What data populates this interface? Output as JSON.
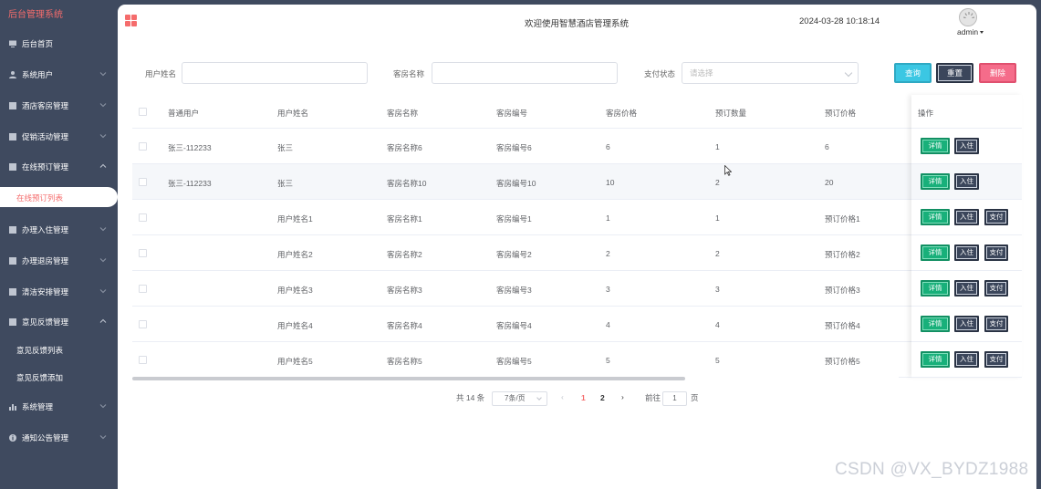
{
  "sidebar": {
    "brand": "后台管理系统",
    "items": [
      {
        "label": "后台首页",
        "icon": "monitor-icon"
      },
      {
        "label": "系统用户",
        "icon": "user-icon"
      },
      {
        "label": "酒店客房管理",
        "icon": "menu-icon"
      },
      {
        "label": "促销活动管理",
        "icon": "menu-icon"
      },
      {
        "label": "在线预订管理",
        "icon": "menu-icon",
        "expanded": true
      },
      {
        "label": "办理入住管理",
        "icon": "menu-icon"
      },
      {
        "label": "办理退房管理",
        "icon": "menu-icon"
      },
      {
        "label": "清洁安排管理",
        "icon": "menu-icon"
      },
      {
        "label": "意见反馈管理",
        "icon": "menu-icon",
        "expanded": true
      },
      {
        "label": "系统管理",
        "icon": "bar-chart-icon"
      },
      {
        "label": "通知公告管理",
        "icon": "info-icon"
      }
    ],
    "active_sub": "在线预订列表",
    "feedback_subs": [
      "意见反馈列表",
      "意见反馈添加"
    ]
  },
  "header": {
    "welcome": "欢迎使用智慧酒店管理系统",
    "datetime": "2024-03-28 10:18:14",
    "username": "admin"
  },
  "search": {
    "user_name_label": "用户姓名",
    "room_name_label": "客房名称",
    "pay_status_label": "支付状态",
    "pay_status_placeholder": "请选择",
    "query_label": "查询",
    "reset_label": "重置",
    "delete_label": "删除"
  },
  "table": {
    "headers": [
      "普通用户",
      "用户姓名",
      "客房名称",
      "客房编号",
      "客房价格",
      "预订数量",
      "预订价格",
      "操作"
    ],
    "rows": [
      {
        "user": "张三-112233",
        "name": "张三",
        "room": "客房名称6",
        "code": "客房编号6",
        "price": "6",
        "qty": "1",
        "total": "6",
        "pay": false
      },
      {
        "user": "张三-112233",
        "name": "张三",
        "room": "客房名称10",
        "code": "客房编号10",
        "price": "10",
        "qty": "2",
        "total": "20",
        "pay": false
      },
      {
        "user": "",
        "name": "用户姓名1",
        "room": "客房名称1",
        "code": "客房编号1",
        "price": "1",
        "qty": "1",
        "total": "预订价格1",
        "pay": true
      },
      {
        "user": "",
        "name": "用户姓名2",
        "room": "客房名称2",
        "code": "客房编号2",
        "price": "2",
        "qty": "2",
        "total": "预订价格2",
        "pay": true
      },
      {
        "user": "",
        "name": "用户姓名3",
        "room": "客房名称3",
        "code": "客房编号3",
        "price": "3",
        "qty": "3",
        "total": "预订价格3",
        "pay": true
      },
      {
        "user": "",
        "name": "用户姓名4",
        "room": "客房名称4",
        "code": "客房编号4",
        "price": "4",
        "qty": "4",
        "total": "预订价格4",
        "pay": true
      },
      {
        "user": "",
        "name": "用户姓名5",
        "room": "客房名称5",
        "code": "客房编号5",
        "price": "5",
        "qty": "5",
        "total": "预订价格5",
        "pay": true
      }
    ],
    "actions": {
      "detail": "详情",
      "checkin": "入住",
      "pay": "支付"
    }
  },
  "pagination": {
    "total": "共 14 条",
    "page_size": "7条/页",
    "pages": [
      "1",
      "2"
    ],
    "goto_label": "前往",
    "goto_value": "1",
    "page_unit": "页"
  },
  "watermark": "CSDN @VX_BYDZ1988",
  "colors": {
    "accent": "#f56c6c",
    "sidebar": "#3f4a5f",
    "detail": "#18b07a",
    "query": "#3bc7e3",
    "delete": "#f56c8a"
  }
}
